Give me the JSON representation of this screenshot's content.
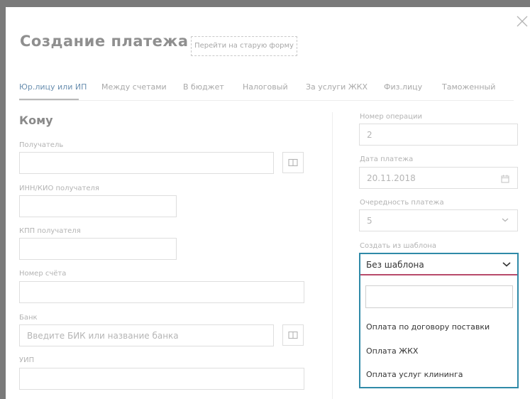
{
  "modal": {
    "title": "Создание платежа",
    "old_form_link": "Перейти на старую форму"
  },
  "tabs": [
    {
      "label": "Юр.лицу или ИП",
      "active": true
    },
    {
      "label": "Между счетами",
      "active": false
    },
    {
      "label": "В бюджет",
      "active": false
    },
    {
      "label": "Налоговый",
      "active": false
    },
    {
      "label": "За услуги ЖКХ",
      "active": false
    },
    {
      "label": "Физ.лицу",
      "active": false
    },
    {
      "label": "Таможенный",
      "active": false
    }
  ],
  "recipient": {
    "section_title": "Кому",
    "recipient_label": "Получатель",
    "recipient_value": "",
    "inn_label": "ИНН/КИО получателя",
    "inn_value": "",
    "kpp_label": "КПП получателя",
    "kpp_value": "",
    "account_label": "Номер счёта",
    "account_value": "",
    "bank_label": "Банк",
    "bank_placeholder": "Введите БИК или название банка",
    "uip_label": "УИП",
    "uip_value": ""
  },
  "payment": {
    "operation_number_label": "Номер операции",
    "operation_number_value": "2",
    "date_label": "Дата платежа",
    "date_value": "20.11.2018",
    "priority_label": "Очередность платежа",
    "priority_value": "5",
    "template_label": "Создать из шаблона",
    "template_value": "Без шаблона",
    "template_search_value": "",
    "template_options": [
      "Оплата по договору поставки",
      "Оплата ЖКХ",
      "Оплата услуг клининга"
    ]
  },
  "icons": {
    "close": "close-icon",
    "book": "book-icon",
    "calendar": "calendar-icon",
    "chevron": "chevron-down-icon"
  },
  "colors": {
    "accent_border": "#2f8aa8",
    "active_underline": "#b84b6a",
    "active_tab": "#6a8fb0"
  }
}
